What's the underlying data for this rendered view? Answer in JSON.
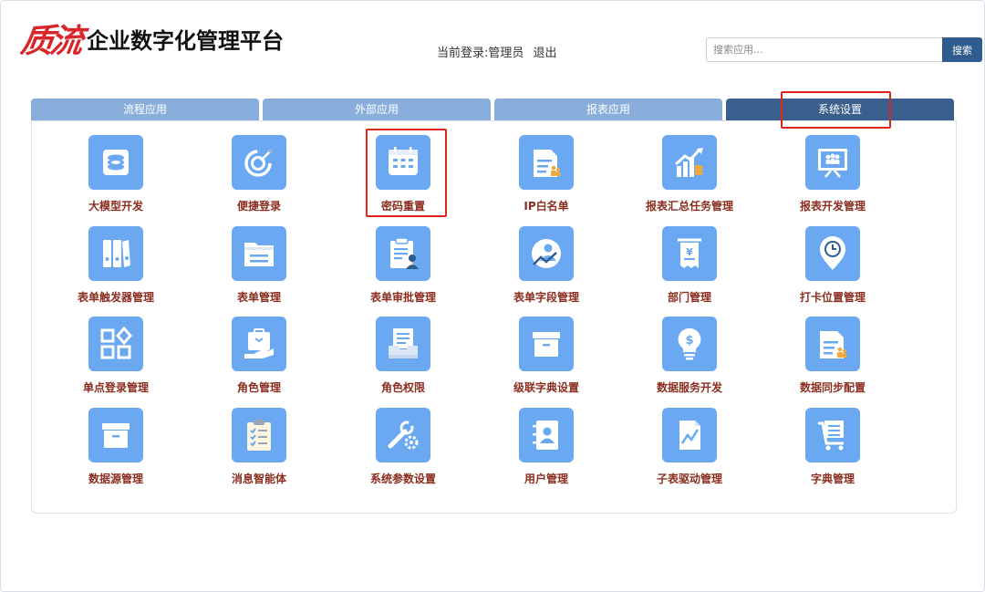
{
  "header": {
    "logo_text": "质流",
    "title": "企业数字化管理平台",
    "login_label": "当前登录:管理员",
    "logout_label": "退出",
    "search_placeholder": "搜索应用...",
    "search_button": "搜索"
  },
  "tabs": [
    {
      "label": "流程应用",
      "active": false
    },
    {
      "label": "外部应用",
      "active": false
    },
    {
      "label": "报表应用",
      "active": false
    },
    {
      "label": "系统设置",
      "active": true
    }
  ],
  "apps": [
    {
      "label": "大模型开发",
      "icon": "coins-icon"
    },
    {
      "label": "便捷登录",
      "icon": "target-icon"
    },
    {
      "label": "密码重置",
      "icon": "calendar-icon"
    },
    {
      "label": "IP白名单",
      "icon": "document-people-icon"
    },
    {
      "label": "报表汇总任务管理",
      "icon": "bar-chart-icon"
    },
    {
      "label": "报表开发管理",
      "icon": "presentation-icon"
    },
    {
      "label": "表单触发器管理",
      "icon": "binders-icon"
    },
    {
      "label": "表单管理",
      "icon": "folder-icon"
    },
    {
      "label": "表单审批管理",
      "icon": "clipboard-user-icon"
    },
    {
      "label": "表单字段管理",
      "icon": "user-chart-icon"
    },
    {
      "label": "部门管理",
      "icon": "receipt-icon"
    },
    {
      "label": "打卡位置管理",
      "icon": "location-clock-icon"
    },
    {
      "label": "单点登录管理",
      "icon": "grid-diamond-icon"
    },
    {
      "label": "角色管理",
      "icon": "briefcase-hand-icon"
    },
    {
      "label": "角色权限",
      "icon": "inbox-document-icon"
    },
    {
      "label": "级联字典设置",
      "icon": "archive-box-icon"
    },
    {
      "label": "数据服务开发",
      "icon": "lightbulb-dollar-icon"
    },
    {
      "label": "数据同步配置",
      "icon": "document-people-icon"
    },
    {
      "label": "数据源管理",
      "icon": "archive-box-icon"
    },
    {
      "label": "消息智能体",
      "icon": "checklist-icon"
    },
    {
      "label": "系统参数设置",
      "icon": "wrench-gear-icon"
    },
    {
      "label": "用户管理",
      "icon": "contact-book-icon"
    },
    {
      "label": "子表驱动管理",
      "icon": "trend-document-icon"
    },
    {
      "label": "字典管理",
      "icon": "cart-icon"
    }
  ]
}
